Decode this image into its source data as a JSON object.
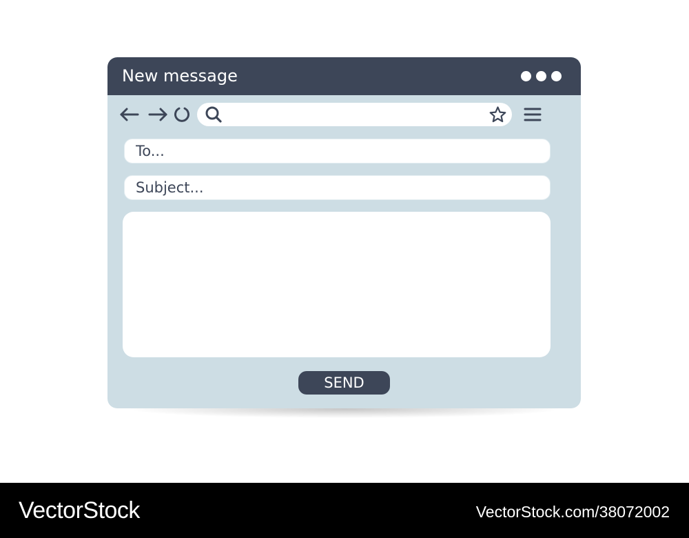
{
  "window": {
    "title": "New message"
  },
  "toolbar": {
    "back_icon": "arrow-left-icon",
    "forward_icon": "arrow-right-icon",
    "reload_icon": "reload-icon",
    "search_icon": "search-icon",
    "bookmark_icon": "star-icon",
    "menu_icon": "hamburger-menu-icon",
    "url_value": ""
  },
  "compose": {
    "to_placeholder": "To...",
    "subject_placeholder": "Subject...",
    "body_value": "",
    "send_label": "SEND"
  },
  "footer": {
    "brand": "VectorStock",
    "url": "VectorStock.com/38072002"
  },
  "colors": {
    "titlebar": "#3d4658",
    "window_bg": "#cddde4",
    "field_bg": "#ffffff",
    "button_bg": "#3d4658",
    "footer_bg": "#000000"
  }
}
